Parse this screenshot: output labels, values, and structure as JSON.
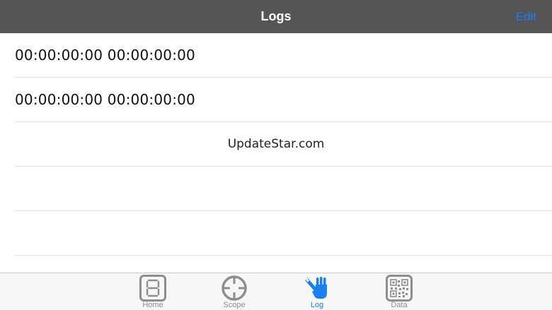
{
  "navbar": {
    "title": "Logs",
    "edit_label": "Edit"
  },
  "colors": {
    "navbar_bg": "#555555",
    "accent": "#1a7ff0",
    "tab_inactive": "#8e8e8e"
  },
  "logs": [
    {
      "text": "00:00:00:00 00:00:00:00"
    },
    {
      "text": "00:00:00:00 00:00:00:00"
    }
  ],
  "watermark": "UpdateStar.com",
  "tabs": [
    {
      "label": "Home",
      "icon": "seven-segment-icon",
      "active": false
    },
    {
      "label": "Scope",
      "icon": "crosshair-icon",
      "active": false
    },
    {
      "label": "Log",
      "icon": "hand-pencil-icon",
      "active": true
    },
    {
      "label": "Data",
      "icon": "qr-code-icon",
      "active": false
    }
  ]
}
